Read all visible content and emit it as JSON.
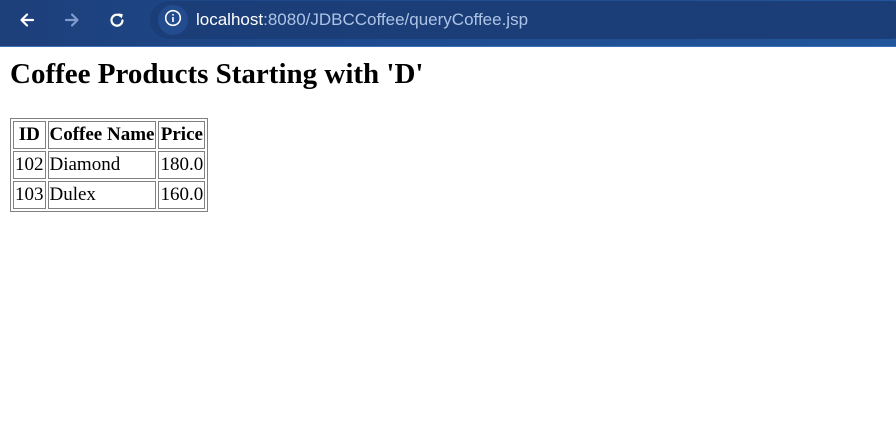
{
  "browser": {
    "url_host": "localhost",
    "url_rest": ":8080/JDBCCoffee/queryCoffee.jsp"
  },
  "page": {
    "heading": "Coffee Products Starting with 'D'",
    "table": {
      "headers": [
        "ID",
        "Coffee Name",
        "Price"
      ],
      "rows": [
        [
          "102",
          "Diamond",
          "180.0"
        ],
        [
          "103",
          "Dulex",
          "160.0"
        ]
      ]
    }
  }
}
